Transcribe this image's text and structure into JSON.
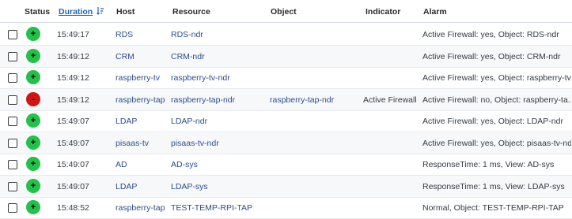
{
  "columns": {
    "status": "Status",
    "duration": "Duration",
    "host": "Host",
    "resource": "Resource",
    "object": "Object",
    "indicator": "Indicator",
    "alarm": "Alarm"
  },
  "colors": {
    "ok": "#23c14a",
    "critical": "#d01515",
    "link": "#2b4d8c"
  },
  "rows": [
    {
      "status": "ok",
      "symbol": "+",
      "duration": "15:49:17",
      "host": "RDS",
      "resource": "RDS-ndr",
      "object": "",
      "indicator": "",
      "alarm": "Active Firewall: yes, Object: RDS-ndr"
    },
    {
      "status": "ok",
      "symbol": "+",
      "duration": "15:49:12",
      "host": "CRM",
      "resource": "CRM-ndr",
      "object": "",
      "indicator": "",
      "alarm": "Active Firewall: yes, Object: CRM-ndr"
    },
    {
      "status": "ok",
      "symbol": "+",
      "duration": "15:49:12",
      "host": "raspberry-tv",
      "resource": "raspberry-tv-ndr",
      "object": "",
      "indicator": "",
      "alarm": "Active Firewall: yes, Object: raspberry-tv..."
    },
    {
      "status": "critical",
      "symbol": "-",
      "duration": "15:49:12",
      "host": "raspberry-tap",
      "resource": "raspberry-tap-ndr",
      "object": "raspberry-tap-ndr",
      "indicator": "Active Firewall",
      "alarm": "Active Firewall: no, Object: raspberry-ta..."
    },
    {
      "status": "ok",
      "symbol": "+",
      "duration": "15:49:07",
      "host": "LDAP",
      "resource": "LDAP-ndr",
      "object": "",
      "indicator": "",
      "alarm": "Active Firewall: yes, Object: LDAP-ndr"
    },
    {
      "status": "ok",
      "symbol": "+",
      "duration": "15:49:07",
      "host": "pisaas-tv",
      "resource": "pisaas-tv-ndr",
      "object": "",
      "indicator": "",
      "alarm": "Active Firewall: yes, Object: pisaas-tv-ndr"
    },
    {
      "status": "ok",
      "symbol": "+",
      "duration": "15:49:07",
      "host": "AD",
      "resource": "AD-sys",
      "object": "",
      "indicator": "",
      "alarm": "ResponseTime: 1 ms, View: AD-sys"
    },
    {
      "status": "ok",
      "symbol": "+",
      "duration": "15:49:07",
      "host": "LDAP",
      "resource": "LDAP-sys",
      "object": "",
      "indicator": "",
      "alarm": "ResponseTime: 1 ms, View: LDAP-sys"
    },
    {
      "status": "ok",
      "symbol": "+",
      "duration": "15:48:52",
      "host": "raspberry-tap",
      "resource": "TEST-TEMP-RPI-TAP",
      "object": "",
      "indicator": "",
      "alarm": "Normal, Object: TEST-TEMP-RPI-TAP"
    }
  ]
}
